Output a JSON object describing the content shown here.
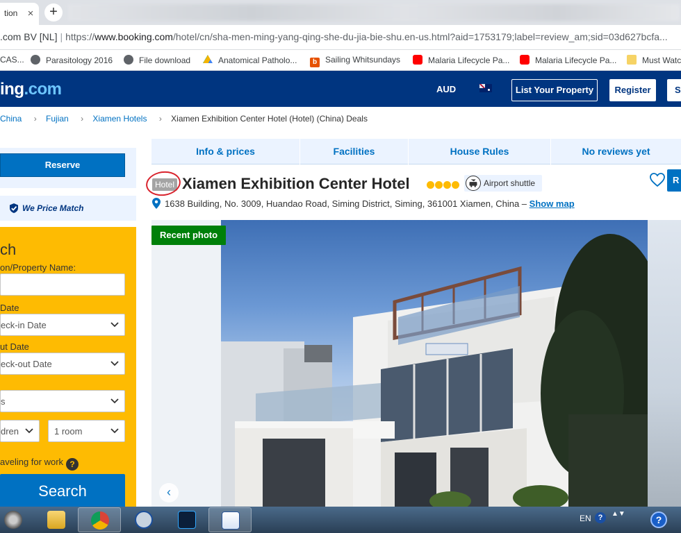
{
  "browser": {
    "tab_title": "tion",
    "tab_close": "×",
    "new_tab": "+",
    "cert_label": ".com BV [NL]",
    "url_separator": "|",
    "url_scheme": "https://",
    "url_host": "www.booking.com",
    "url_path": "/hotel/cn/sha-men-ming-yang-qing-she-du-jia-bie-shu.en-us.html?aid=1753179;label=review_am;sid=03d627bcfa...",
    "bookmarks": [
      {
        "label": "CAS...",
        "icon": "none"
      },
      {
        "label": "Parasitology 2016",
        "icon": "globe-icon"
      },
      {
        "label": "File download",
        "icon": "globe-icon"
      },
      {
        "label": "Anatomical Patholo...",
        "icon": "drive-icon"
      },
      {
        "label": "Sailing Whitsundays",
        "icon": "b-icon"
      },
      {
        "label": "Malaria Lifecycle Pa...",
        "icon": "youtube-icon"
      },
      {
        "label": "Malaria Lifecycle Pa...",
        "icon": "youtube-icon"
      },
      {
        "label": "Must Watc",
        "icon": "folder-icon"
      }
    ]
  },
  "header": {
    "logo_main": "ing",
    "logo_dotcom": ".com",
    "currency": "AUD",
    "list_property": "List Your Property",
    "register": "Register",
    "signin": "Si"
  },
  "breadcrumb": {
    "items": [
      "China",
      "Fujian",
      "Xiamen Hotels"
    ],
    "separator": "›",
    "current": "Xiamen Exhibition Center Hotel (Hotel) (China) Deals"
  },
  "sidebar": {
    "reserve": "Reserve",
    "price_match": "We Price Match",
    "search_title": "ch",
    "destination_label": "on/Property Name:",
    "destination_value": "",
    "checkin_label": " Date",
    "checkin_placeholder": "eck-in Date",
    "checkout_label": "ut Date",
    "checkout_placeholder": "eck-out Date",
    "guests_value": "s",
    "children_value": "dren",
    "rooms_value": "1 room",
    "work_label": "aveling for work",
    "help": "?",
    "search_button": "Search"
  },
  "main_nav": {
    "tabs": [
      "Info & prices",
      "Facilities",
      "House Rules",
      "No reviews yet"
    ]
  },
  "hotel": {
    "type_badge": "Hotel",
    "name": "Xiamen Exhibition Center Hotel",
    "stars": 4,
    "shuttle": "Airport shuttle",
    "address": "1638 Building, No. 3009, Huandao Road, Siming District, Siming, 361001 Xiamen, China –",
    "show_map": "Show map",
    "reserve_mini": "R"
  },
  "photo": {
    "recent_badge": "Recent photo",
    "prev_arrow": "‹"
  },
  "taskbar": {
    "lang": "EN",
    "help": "?",
    "tray_arrows": "▲▼",
    "big_help": "?",
    "apps": [
      "media-icon",
      "explorer-icon",
      "chrome-icon",
      "hp-icon",
      "photoshop-icon",
      "word-icon"
    ]
  },
  "colors": {
    "brand_blue": "#003580",
    "link_blue": "#0071c2",
    "search_yellow": "#febb02",
    "recent_green": "#008009",
    "annotation_red": "#d9232d"
  }
}
